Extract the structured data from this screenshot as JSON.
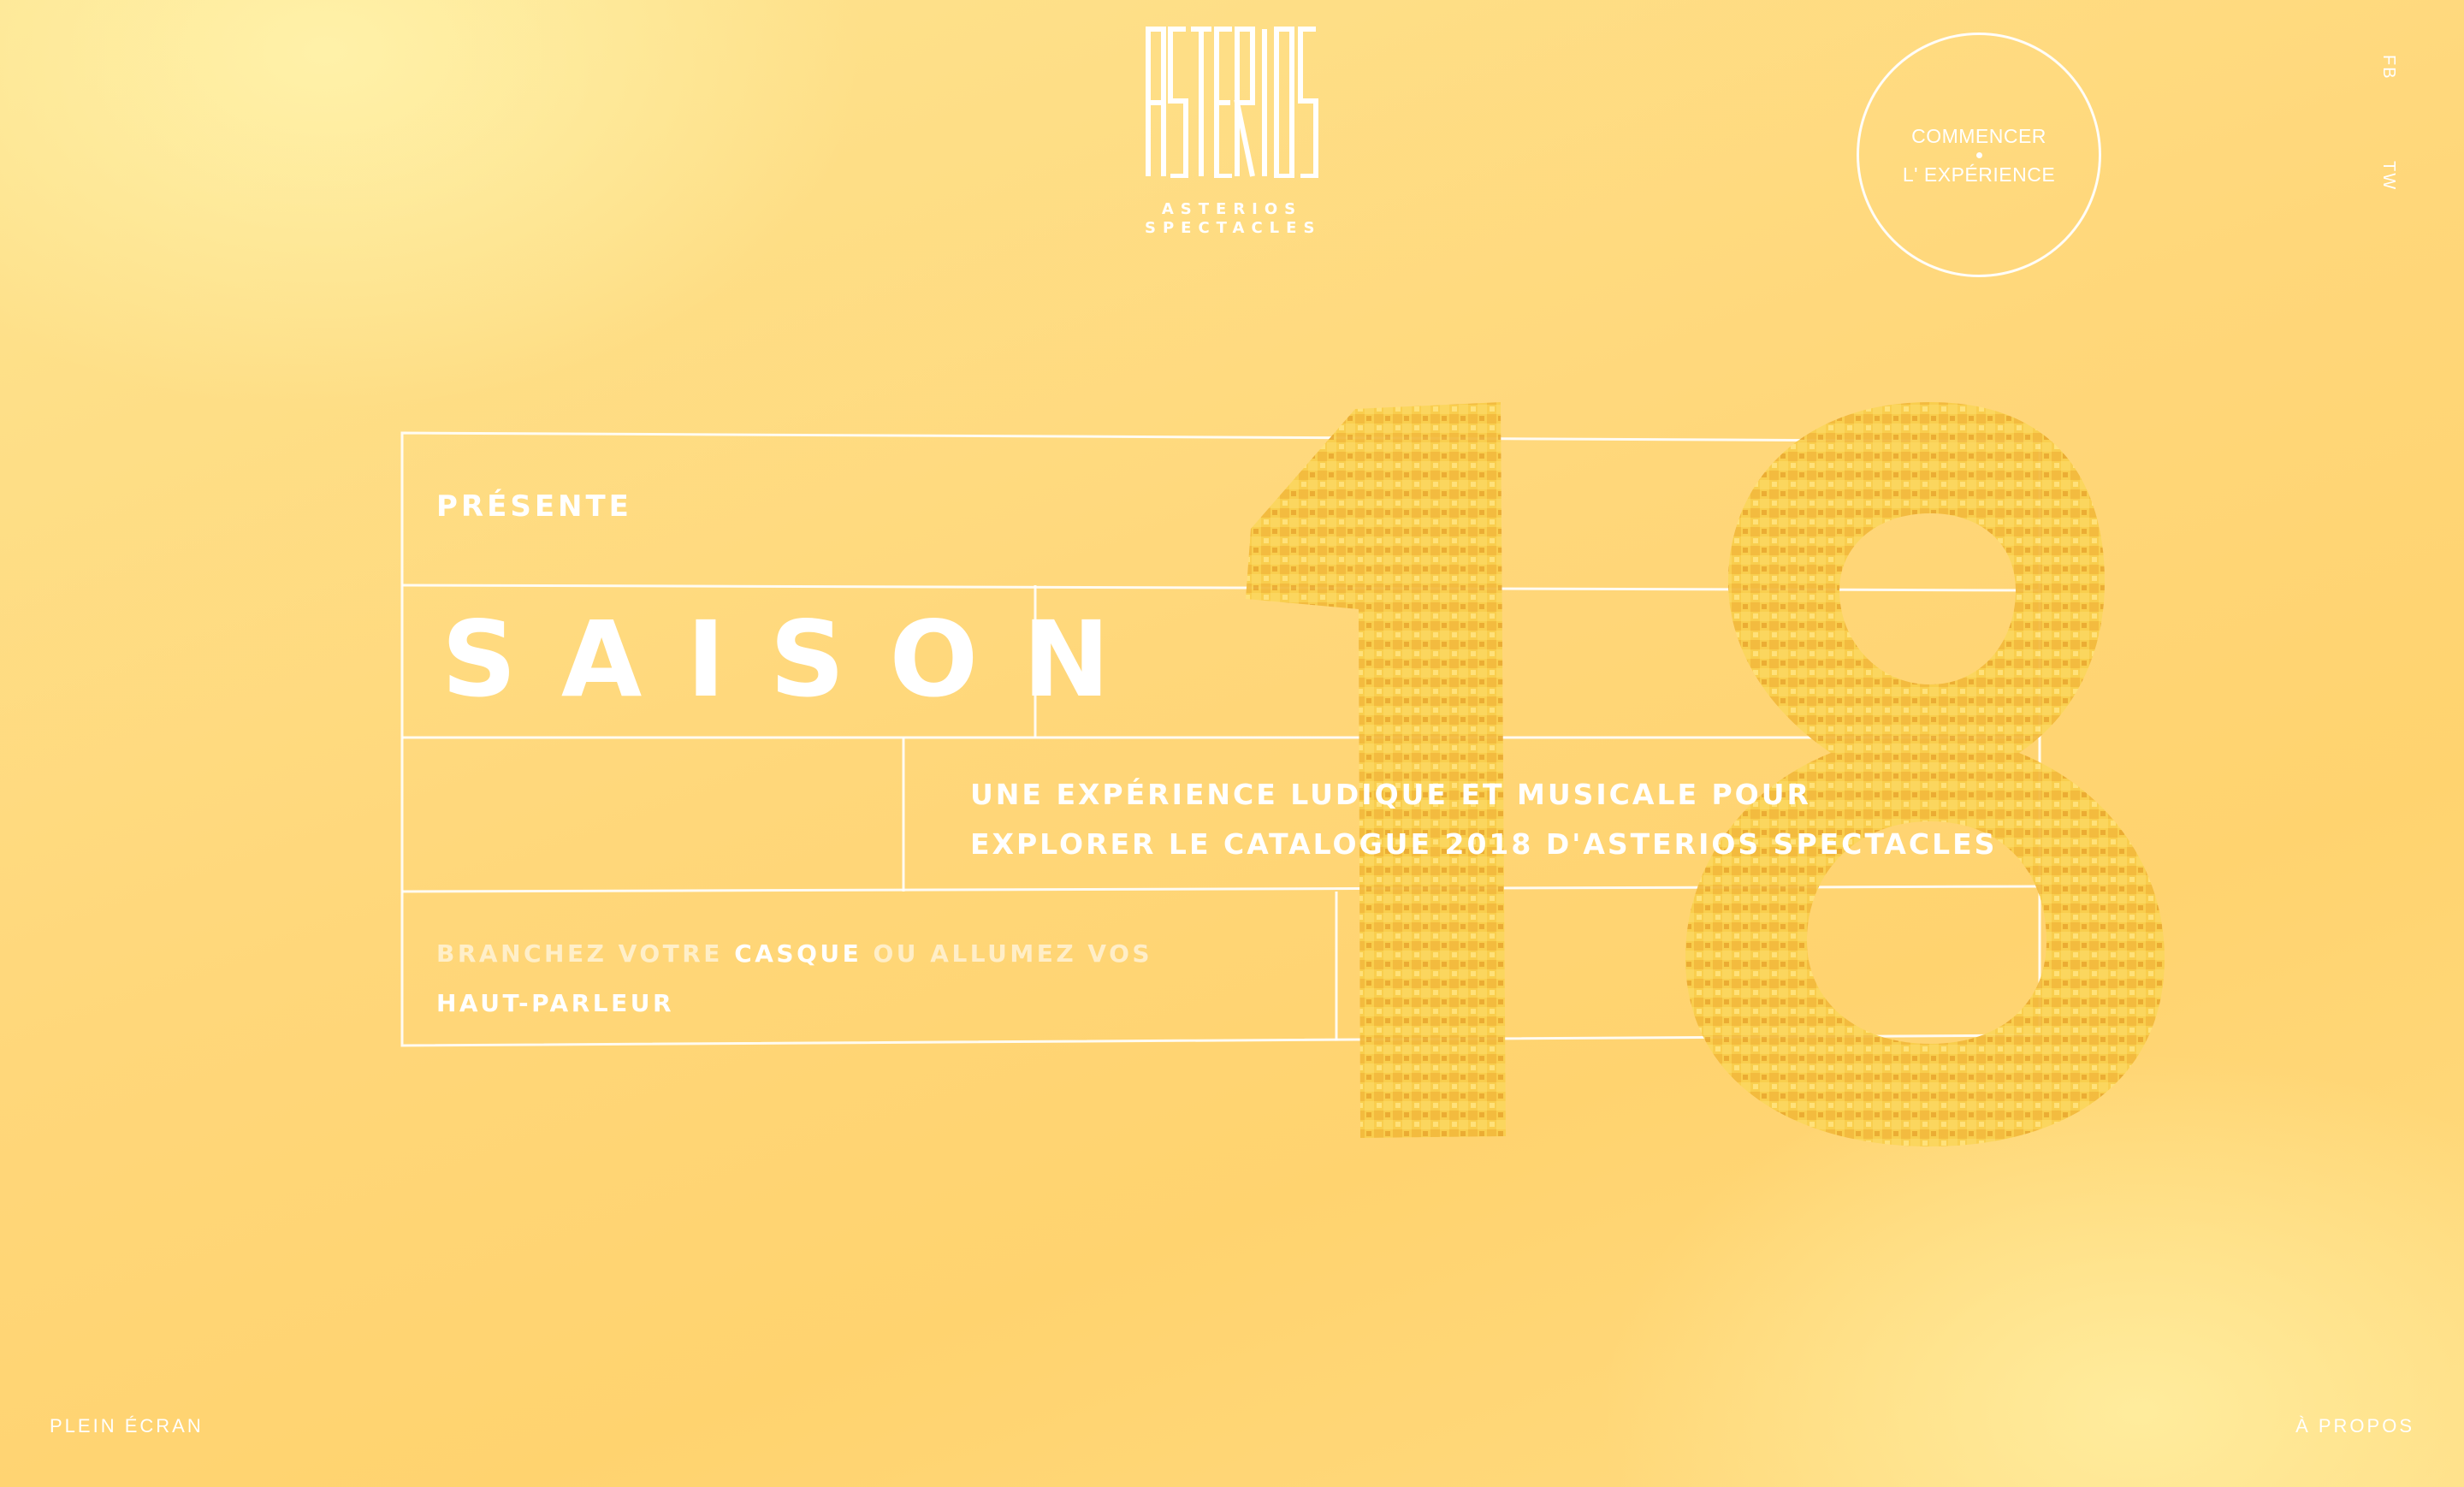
{
  "brand": {
    "logo_lines": [
      "ASTERIOS",
      "SPECTACLES"
    ]
  },
  "cta": {
    "line1": "COMMENCER",
    "line2": "L' EXPÉRIENCE"
  },
  "social": {
    "fb": "FB",
    "tw": "TW"
  },
  "intro": {
    "presente": "PRÉSENTE",
    "title": "SAISON",
    "number": "18",
    "desc_line1": "UNE EXPÉRIENCE LUDIQUE ET MUSICALE POUR",
    "desc_line2": "EXPLORER LE CATALOGUE 2018 D'ASTERIOS SPECTACLES",
    "hint_part1": "BRANCHEZ VOTRE ",
    "hint_strong": "CASQUE",
    "hint_part2": " OU ALLUMEZ VOS",
    "hint_line2": "HAUT-PARLEUR"
  },
  "footer": {
    "fullscreen": "PLEIN ÉCRAN",
    "about": "À PROPOS"
  },
  "colors": {
    "background": "#ffd77a",
    "accent": "#ffffff",
    "number_fill": "#f7c53a"
  }
}
